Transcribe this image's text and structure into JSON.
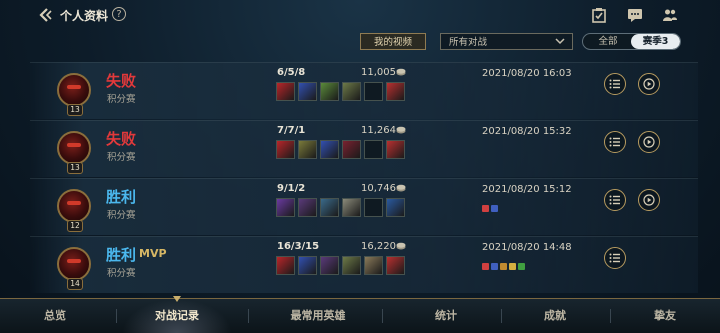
{
  "header": {
    "title": "个人资料",
    "help": "?",
    "icons": [
      "task-check-icon",
      "chat-icon",
      "friends-icon"
    ]
  },
  "toolbar": {
    "my_videos_label": "我的视频",
    "mode_select_value": "所有对战",
    "segment": {
      "all_label": "全部",
      "season_label": "赛季3"
    }
  },
  "matches": [
    {
      "result": "失败",
      "result_type": "loss",
      "mvp": "",
      "queue": "积分赛",
      "level": "13",
      "kda": "6/5/8",
      "gold": "11,005",
      "time": "2021/08/20 16:03",
      "items": [
        "#b8262a",
        "#3250b0",
        "#5a8a3a",
        "#6d7a48",
        "",
        "#b83030"
      ],
      "badges": []
    },
    {
      "result": "失败",
      "result_type": "loss",
      "mvp": "",
      "queue": "积分赛",
      "level": "13",
      "kda": "7/7/1",
      "gold": "11,264",
      "time": "2021/08/20 15:32",
      "items": [
        "#b8262a",
        "#7a7a3a",
        "#3250b0",
        "#7a2230",
        "",
        "#b83030"
      ],
      "badges": []
    },
    {
      "result": "胜利",
      "result_type": "win",
      "mvp": "",
      "queue": "积分赛",
      "level": "12",
      "kda": "9/1/2",
      "gold": "10,746",
      "time": "2021/08/20 15:12",
      "items": [
        "#6a3aa0",
        "#5a3a7a",
        "#3a6a8a",
        "#8a8a7a",
        "",
        "#2a5aa0"
      ],
      "badges": [
        "#d04040",
        "#4060c0"
      ]
    },
    {
      "result": "胜利",
      "result_type": "win",
      "mvp": "MVP",
      "queue": "积分赛",
      "level": "14",
      "kda": "16/3/15",
      "gold": "16,220",
      "time": "2021/08/20 14:48",
      "items": [
        "#b8262a",
        "#3250b0",
        "#5a3a7a",
        "#6d7a48",
        "#8a7a5a",
        "#b83030"
      ],
      "badges": [
        "#d04040",
        "#4060c0",
        "#c08a30",
        "#d4b040",
        "#40a040"
      ]
    }
  ],
  "tabs": [
    {
      "label": "总览"
    },
    {
      "label": "对战记录"
    },
    {
      "label": "最常用英雄"
    },
    {
      "label": "统计"
    },
    {
      "label": "成就"
    },
    {
      "label": "挚友"
    }
  ],
  "active_tab": 1,
  "colors": {
    "loss": "#e2393b",
    "win": "#4bb8ee",
    "gold_accent": "#b89c60",
    "mvp": "#d6b765"
  }
}
